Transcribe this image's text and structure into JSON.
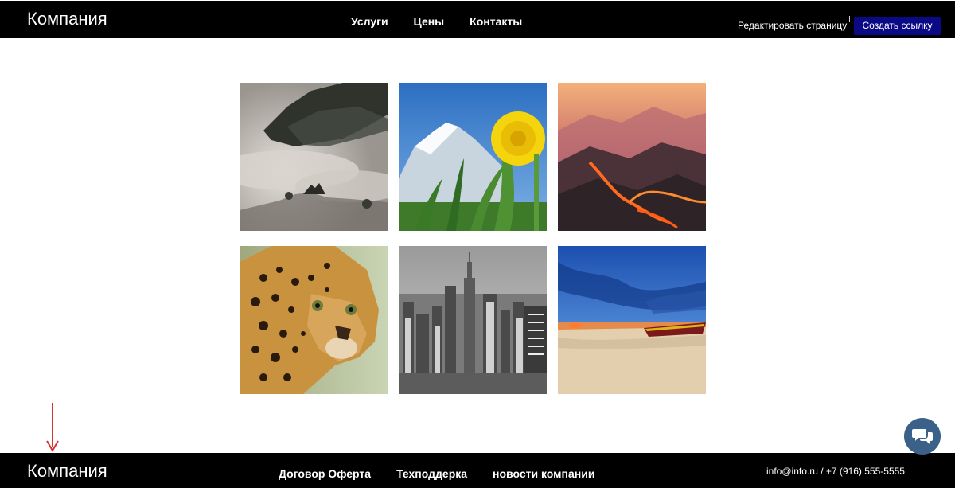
{
  "header": {
    "brand": "Компания",
    "nav": [
      "Услуги",
      "Цены",
      "Контакты"
    ],
    "edit_label": "Редактировать страницу",
    "create_link_label": "Создать ссылку"
  },
  "gallery": {
    "images": [
      "misty-mountains",
      "dandelion-snowy-peak",
      "volcanic-lava-valley",
      "leopard-portrait",
      "city-skyline-bw",
      "beach-sunset-boat"
    ]
  },
  "footer": {
    "brand": "Компания",
    "nav": [
      "Договор Оферта",
      "Техподдерка",
      "новости компании"
    ],
    "contact": "info@info.ru / +7 (916) 555-5555"
  },
  "colors": {
    "bar": "#000000",
    "button": "#0a0a86",
    "chat": "#3b6188",
    "arrow": "#d9342b"
  }
}
